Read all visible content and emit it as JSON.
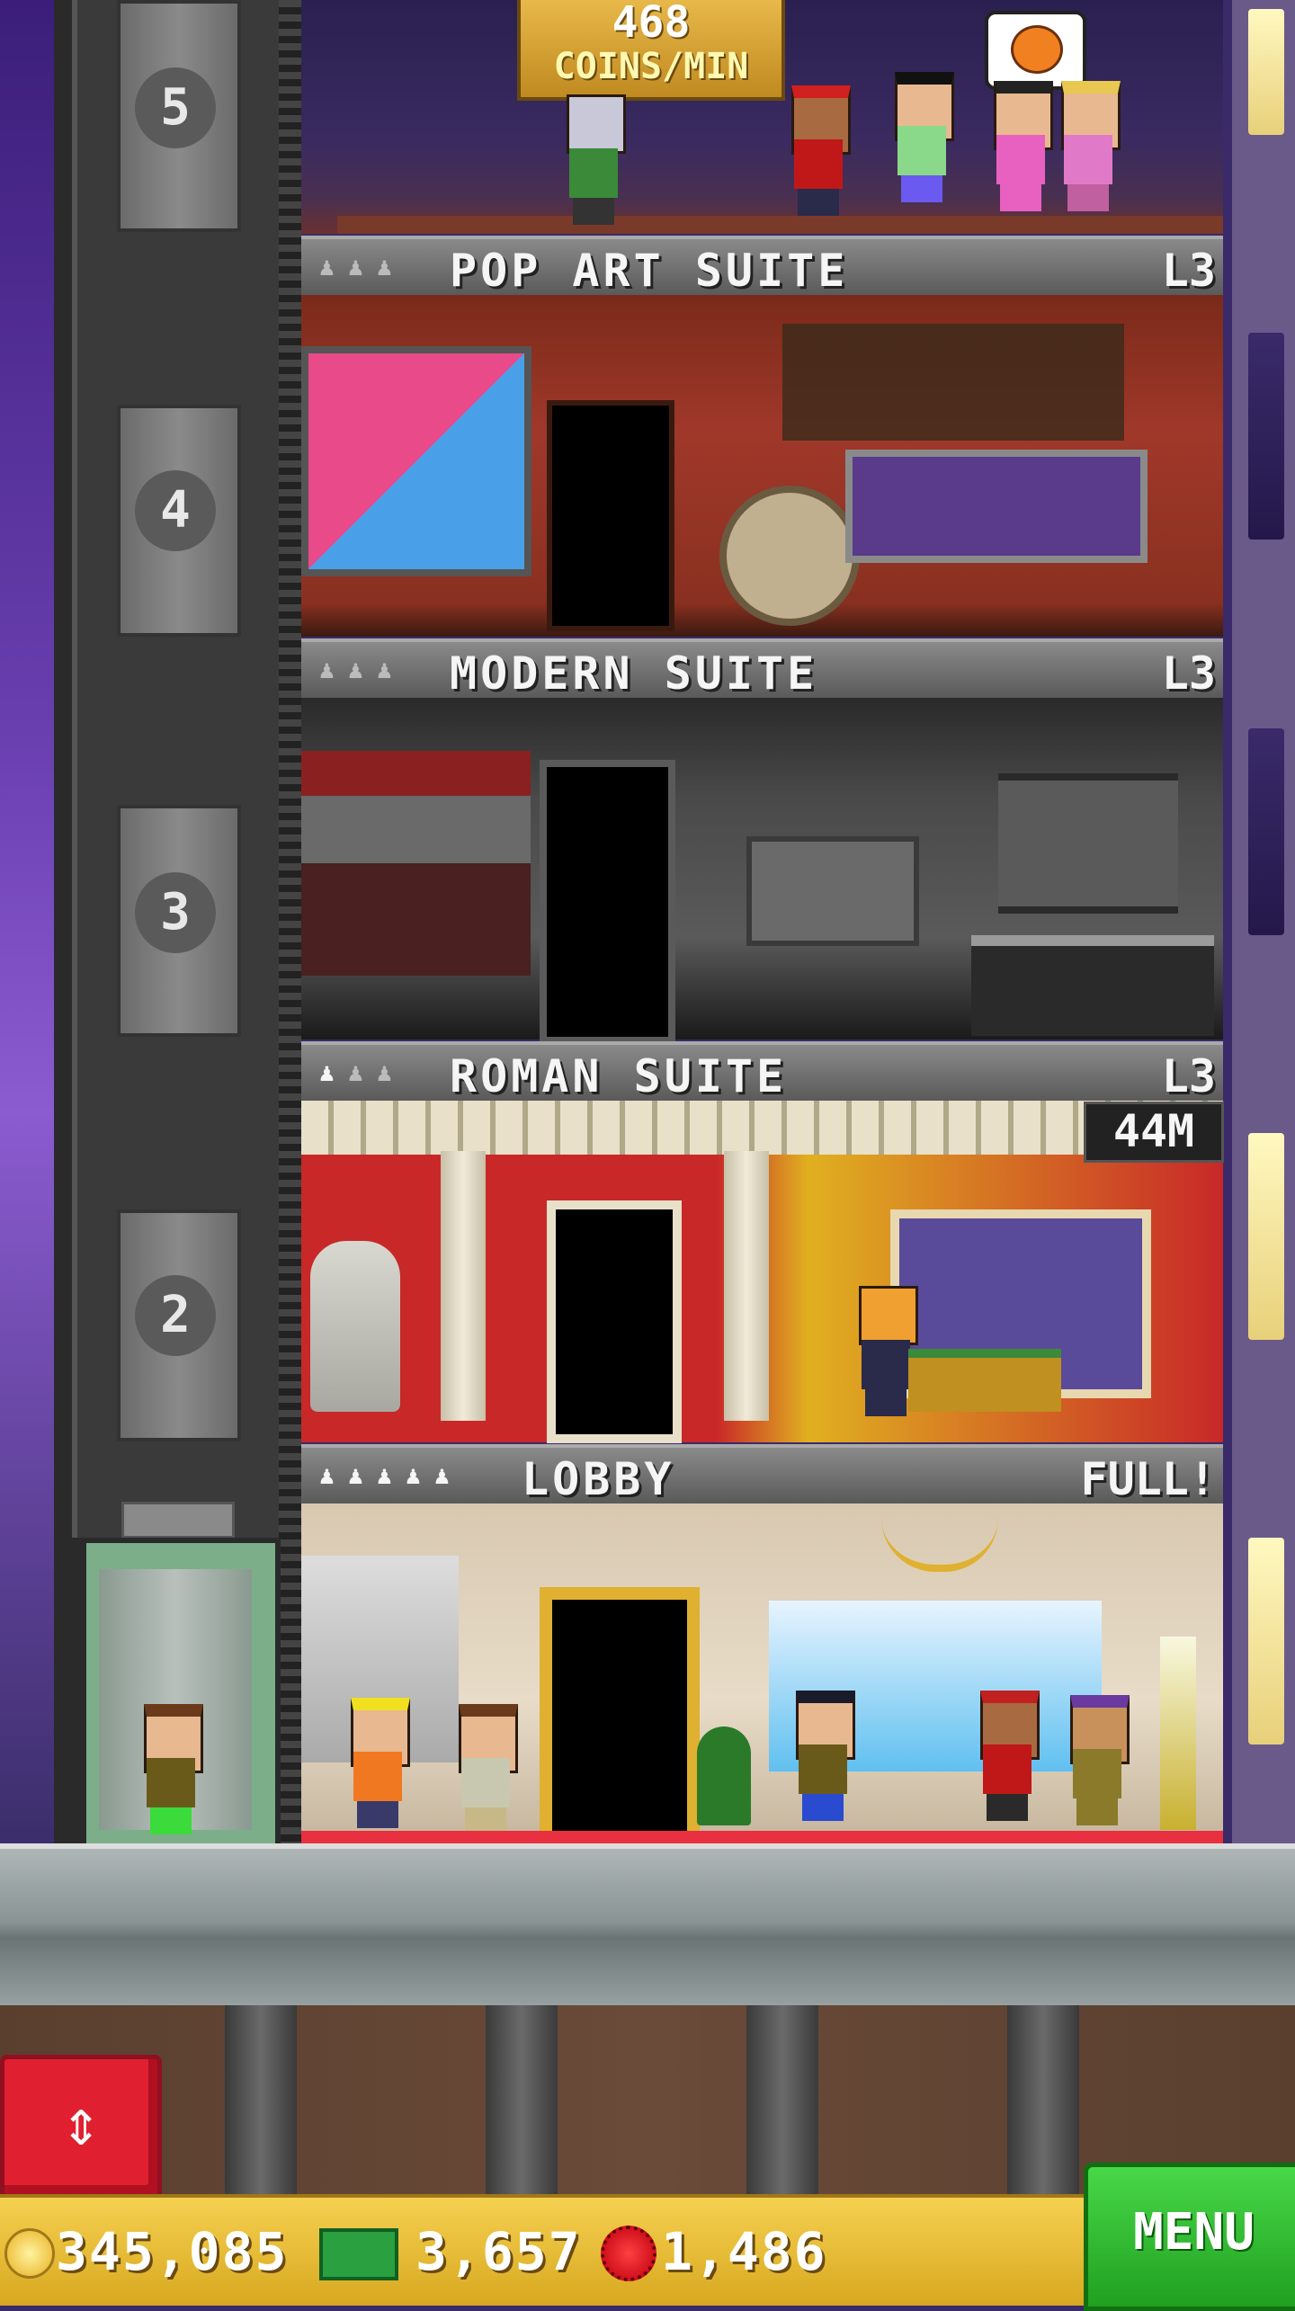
{
  "coins_per_min": {
    "value": "468",
    "label": "COINS/MIN"
  },
  "floors": [
    {
      "number": "5",
      "name": "POP ART SUITE",
      "level": "L3",
      "occupancy": 3,
      "occupied": 0
    },
    {
      "number": "4",
      "name": "MODERN SUITE",
      "level": "L3",
      "occupancy": 3,
      "occupied": 0
    },
    {
      "number": "3",
      "name": "ROMAN SUITE",
      "level": "L3",
      "occupancy": 3,
      "occupied": 1
    },
    {
      "number": "2",
      "name": "LOBBY",
      "level": "FULL!",
      "occupancy": 5,
      "occupied": 5
    }
  ],
  "roman_timer": "44M",
  "hud": {
    "coins": "345,085",
    "bux": "3,657",
    "bits": "1,486",
    "menu_label": "MENU"
  },
  "colors": {
    "accent_menu": "#20a020",
    "elevator_button": "#e02030",
    "coins_bar": "#d8a820"
  }
}
